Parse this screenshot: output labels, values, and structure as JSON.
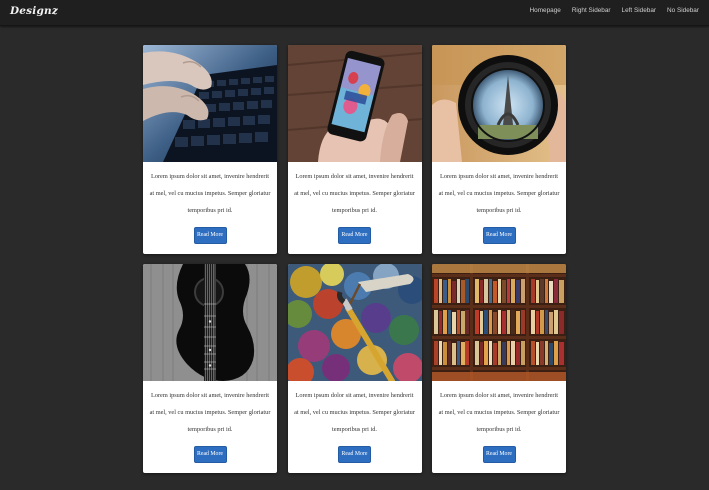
{
  "brand": "Designz",
  "nav": [
    "Homepage",
    "Right Sidebar",
    "Left Sidebar",
    "No Sidebar"
  ],
  "card_text": "Lorem ipsum dolor sit amet, invenire hendrerit at mel, vel cu mucius impetus. Semper gloriatur temporibus pri id.",
  "button_label": "Read More",
  "cards": [
    {
      "image": "keyboard-typing-photo"
    },
    {
      "image": "smartphone-balloons-photo"
    },
    {
      "image": "camera-lens-photo"
    },
    {
      "image": "acoustic-guitar-photo"
    },
    {
      "image": "paint-palette-photo"
    },
    {
      "image": "bookshelf-photo"
    }
  ],
  "colors": {
    "page_bg": "#2a2a2a",
    "navbar_bg": "#1f1f1f",
    "button_bg": "#2e6ec1"
  }
}
